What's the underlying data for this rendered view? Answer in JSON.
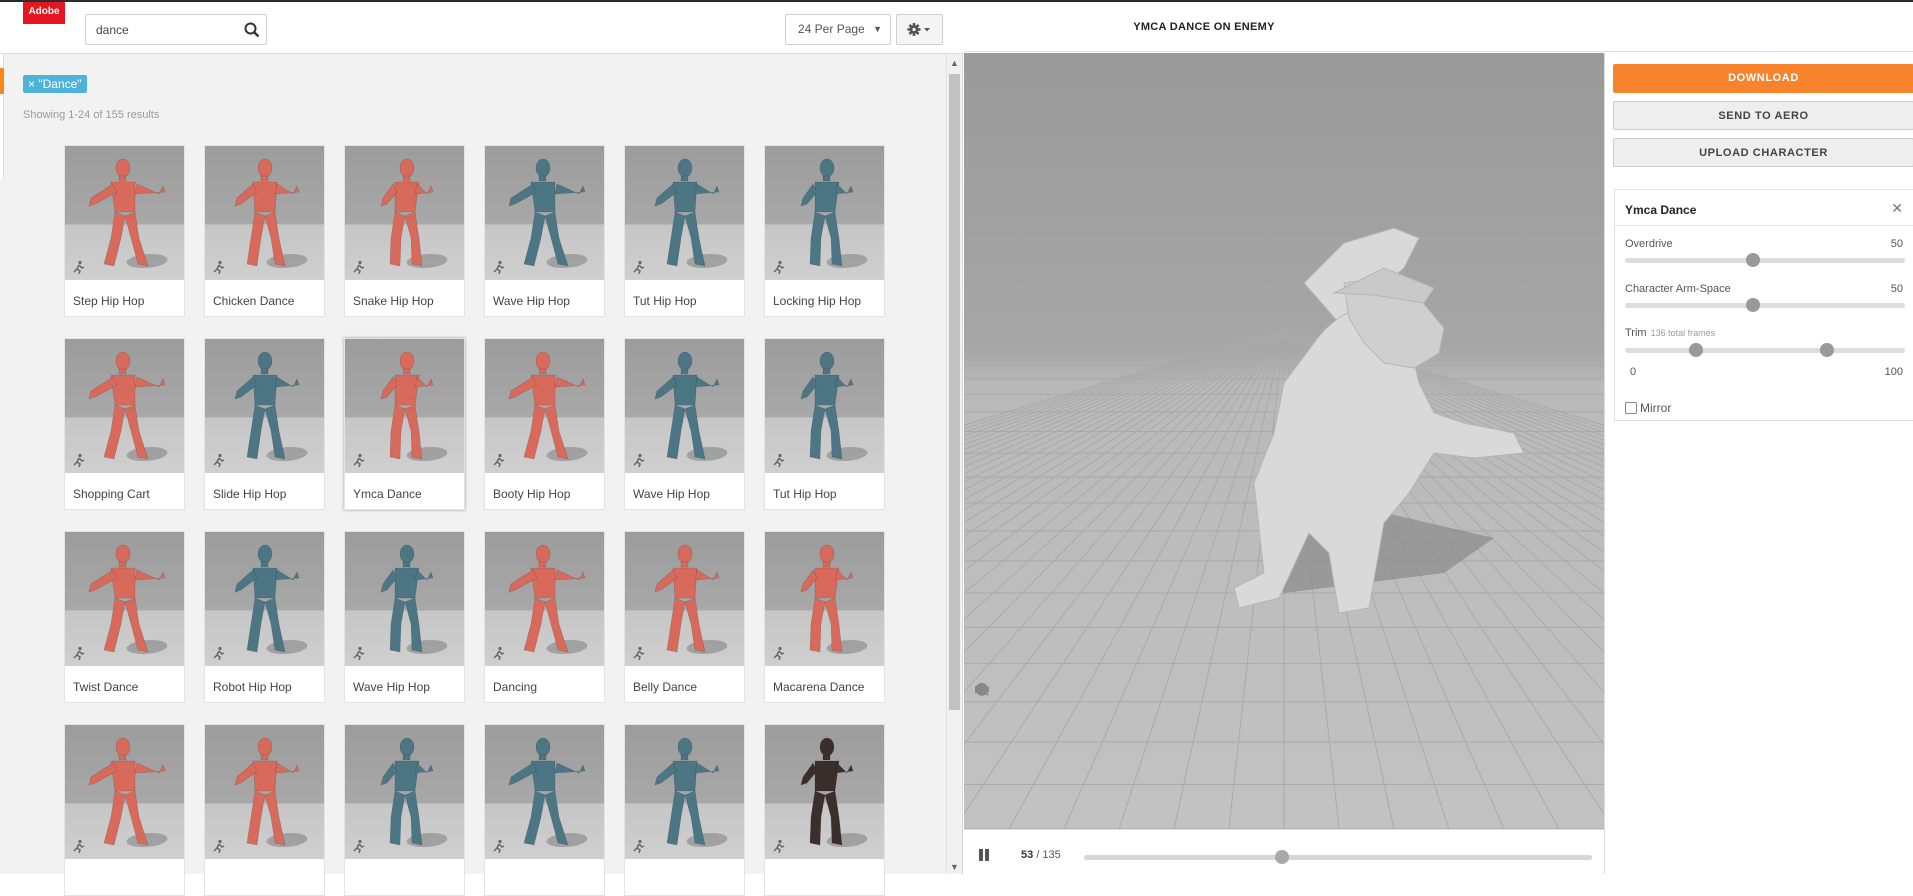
{
  "app": {
    "logo_text": "Adobe"
  },
  "search": {
    "value": "dance"
  },
  "toolbar": {
    "per_page": "24 Per Page"
  },
  "filter": {
    "tag": "× \"Dance\""
  },
  "results": {
    "summary": "Showing 1-24 of 155 results"
  },
  "animations": [
    {
      "label": "Step Hip Hop",
      "color": "#d86a5c"
    },
    {
      "label": "Chicken Dance",
      "color": "#d86a5c"
    },
    {
      "label": "Snake Hip Hop",
      "color": "#d86a5c"
    },
    {
      "label": "Wave Hip Hop",
      "color": "#4d7684"
    },
    {
      "label": "Tut Hip Hop",
      "color": "#4d7684"
    },
    {
      "label": "Locking Hip Hop",
      "color": "#4d7684"
    },
    {
      "label": "Shopping Cart",
      "color": "#d86a5c"
    },
    {
      "label": "Slide Hip Hop",
      "color": "#4d7684"
    },
    {
      "label": "Ymca Dance",
      "color": "#d86a5c",
      "selected": true
    },
    {
      "label": "Booty Hip Hop",
      "color": "#d86a5c"
    },
    {
      "label": "Wave Hip Hop",
      "color": "#4d7684"
    },
    {
      "label": "Tut Hip Hop",
      "color": "#4d7684"
    },
    {
      "label": "Twist Dance",
      "color": "#d86a5c"
    },
    {
      "label": "Robot Hip Hop",
      "color": "#4d7684"
    },
    {
      "label": "Wave Hip Hop",
      "color": "#4d7684"
    },
    {
      "label": "Dancing",
      "color": "#d86a5c"
    },
    {
      "label": "Belly Dance",
      "color": "#d86a5c"
    },
    {
      "label": "Macarena Dance",
      "color": "#d86a5c"
    },
    {
      "label": "",
      "color": "#d86a5c"
    },
    {
      "label": "",
      "color": "#d86a5c"
    },
    {
      "label": "",
      "color": "#4d7684"
    },
    {
      "label": "",
      "color": "#4d7684"
    },
    {
      "label": "",
      "color": "#4d7684"
    },
    {
      "label": "",
      "color": "#3b2f2c"
    }
  ],
  "viewer": {
    "title": "YMCA DANCE ON ENEMY",
    "frame_current": "53",
    "frame_total": "/ 135",
    "progress": 0.39
  },
  "actions": {
    "download": "DOWNLOAD",
    "send": "SEND TO AERO",
    "upload": "UPLOAD CHARACTER"
  },
  "settings": {
    "title": "Ymca Dance",
    "overdrive_label": "Overdrive",
    "overdrive_value": "50",
    "armspace_label": "Character Arm-Space",
    "armspace_value": "50",
    "trim_label": "Trim",
    "trim_sub": "136 total frames",
    "trim_min": "0",
    "trim_max": "100",
    "mirror_label": "Mirror"
  }
}
